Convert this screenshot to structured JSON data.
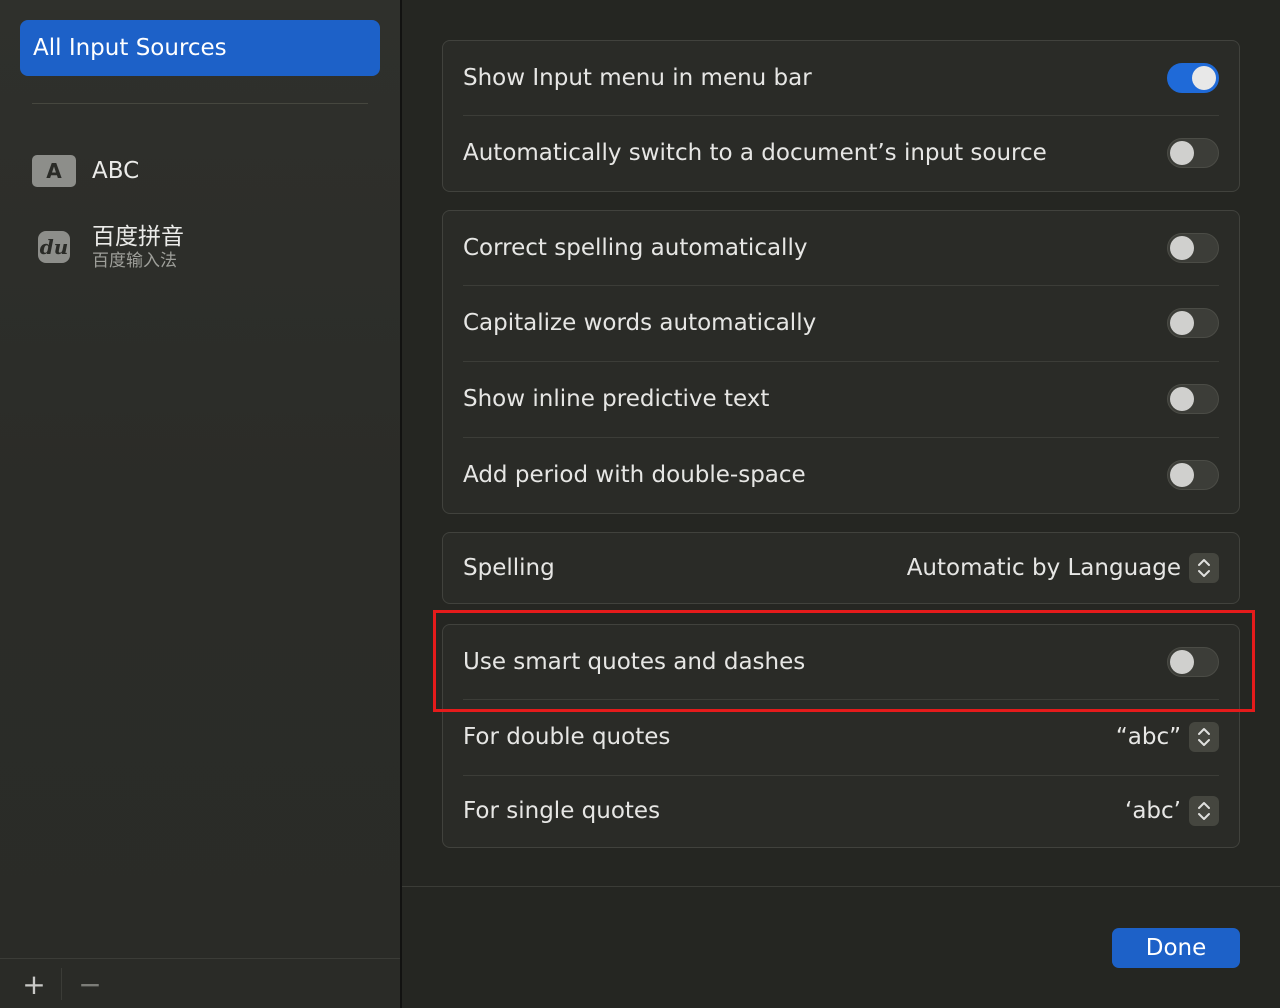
{
  "sidebar": {
    "selected_label": "All Input Sources",
    "sources": [
      {
        "icon_text": "A",
        "icon": "letter-a-icon",
        "name": "ABC"
      },
      {
        "icon_text": "du",
        "icon": "baidu-du-icon",
        "name": "百度拼音",
        "subtitle": "百度输入法"
      }
    ],
    "add_label": "+",
    "remove_label": "−"
  },
  "groups": {
    "menu": [
      {
        "label": "Show Input menu in menu bar",
        "on": true
      },
      {
        "label": "Automatically switch to a document’s input source",
        "on": false
      }
    ],
    "typing": [
      {
        "label": "Correct spelling automatically",
        "on": false
      },
      {
        "label": "Capitalize words automatically",
        "on": false
      },
      {
        "label": "Show inline predictive text",
        "on": false
      },
      {
        "label": "Add period with double-space",
        "on": false
      }
    ],
    "spelling": {
      "label": "Spelling",
      "value": "Automatic by Language"
    },
    "quotes": {
      "smart_label": "Use smart quotes and dashes",
      "smart_on": false,
      "double_label": "For double quotes",
      "double_value": "“abc”",
      "single_label": "For single quotes",
      "single_value": "‘abc’"
    }
  },
  "footer": {
    "done_label": "Done"
  },
  "colors": {
    "accent": "#1d61c8",
    "highlight": "#e51b1b",
    "background": "#252622"
  }
}
